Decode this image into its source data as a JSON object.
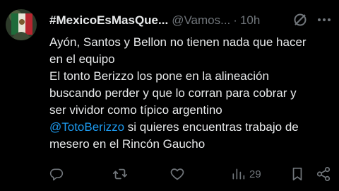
{
  "tweet": {
    "display_name": "#MexicoEsMasQue...",
    "handle": "@Vamos...",
    "separator": "·",
    "time": "10h",
    "body_lines": [
      "Ayón, Santos y Bellon no tienen nada que hacer",
      "en el equipo",
      "El tonto Berizzo los pone en la alineación",
      "buscando perder y que lo corran para cobrar y",
      "ser vividor como típico argentino"
    ],
    "mention": "@TotoBerizzo",
    "mention_rest": " si quieres encuentras trabajo de",
    "last_line": "mesero en el Rincón Gaucho"
  },
  "actions": {
    "reply_icon": "reply-icon",
    "retweet_icon": "retweet-icon",
    "like_icon": "heart-icon",
    "views_icon": "views-icon",
    "views_count": "29",
    "bookmark_icon": "bookmark-icon",
    "share_icon": "share-icon"
  },
  "colors": {
    "background": "#000000",
    "text": "#e7e9ea",
    "secondary": "#71767b",
    "link": "#1d9bf0"
  }
}
